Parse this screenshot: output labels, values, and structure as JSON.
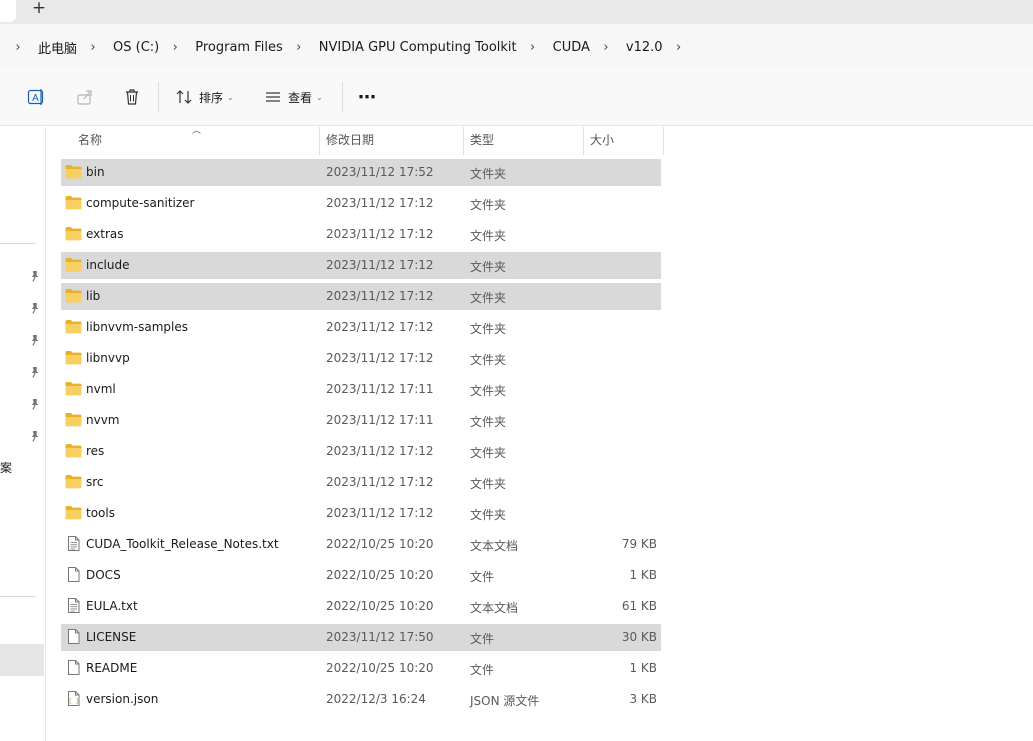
{
  "tabs": {
    "new_tab_label": "+"
  },
  "breadcrumb": [
    "此电脑",
    "OS (C:)",
    "Program Files",
    "NVIDIA GPU Computing Toolkit",
    "CUDA",
    "v12.0"
  ],
  "commandbar": {
    "sort_label": "排序",
    "view_label": "查看",
    "more_label": "⋯"
  },
  "navpane": {
    "truncated_label": "案"
  },
  "columns": {
    "name": "名称",
    "date": "修改日期",
    "type": "类型",
    "size": "大小"
  },
  "files": [
    {
      "name": "bin",
      "date": "2023/11/12 17:52",
      "type": "文件夹",
      "size": "",
      "icon": "folder-icon",
      "selected": true
    },
    {
      "name": "compute-sanitizer",
      "date": "2023/11/12 17:12",
      "type": "文件夹",
      "size": "",
      "icon": "folder-icon",
      "selected": false
    },
    {
      "name": "extras",
      "date": "2023/11/12 17:12",
      "type": "文件夹",
      "size": "",
      "icon": "folder-icon",
      "selected": false
    },
    {
      "name": "include",
      "date": "2023/11/12 17:12",
      "type": "文件夹",
      "size": "",
      "icon": "folder-icon",
      "selected": true
    },
    {
      "name": "lib",
      "date": "2023/11/12 17:12",
      "type": "文件夹",
      "size": "",
      "icon": "folder-icon",
      "selected": true
    },
    {
      "name": "libnvvm-samples",
      "date": "2023/11/12 17:12",
      "type": "文件夹",
      "size": "",
      "icon": "folder-icon",
      "selected": false
    },
    {
      "name": "libnvvp",
      "date": "2023/11/12 17:12",
      "type": "文件夹",
      "size": "",
      "icon": "folder-icon",
      "selected": false
    },
    {
      "name": "nvml",
      "date": "2023/11/12 17:11",
      "type": "文件夹",
      "size": "",
      "icon": "folder-icon",
      "selected": false
    },
    {
      "name": "nvvm",
      "date": "2023/11/12 17:11",
      "type": "文件夹",
      "size": "",
      "icon": "folder-icon",
      "selected": false
    },
    {
      "name": "res",
      "date": "2023/11/12 17:12",
      "type": "文件夹",
      "size": "",
      "icon": "folder-icon",
      "selected": false
    },
    {
      "name": "src",
      "date": "2023/11/12 17:12",
      "type": "文件夹",
      "size": "",
      "icon": "folder-icon",
      "selected": false
    },
    {
      "name": "tools",
      "date": "2023/11/12 17:12",
      "type": "文件夹",
      "size": "",
      "icon": "folder-icon",
      "selected": false
    },
    {
      "name": "CUDA_Toolkit_Release_Notes.txt",
      "date": "2022/10/25 10:20",
      "type": "文本文档",
      "size": "79 KB",
      "icon": "text-file-icon",
      "selected": false
    },
    {
      "name": "DOCS",
      "date": "2022/10/25 10:20",
      "type": "文件",
      "size": "1 KB",
      "icon": "file-icon",
      "selected": false
    },
    {
      "name": "EULA.txt",
      "date": "2022/10/25 10:20",
      "type": "文本文档",
      "size": "61 KB",
      "icon": "text-file-icon",
      "selected": false
    },
    {
      "name": "LICENSE",
      "date": "2023/11/12 17:50",
      "type": "文件",
      "size": "30 KB",
      "icon": "file-icon",
      "selected": true
    },
    {
      "name": "README",
      "date": "2022/10/25 10:20",
      "type": "文件",
      "size": "1 KB",
      "icon": "file-icon",
      "selected": false
    },
    {
      "name": "version.json",
      "date": "2022/12/3 16:24",
      "type": "JSON 源文件",
      "size": "3 KB",
      "icon": "json-file-icon",
      "selected": false
    }
  ],
  "colors": {
    "selected_row": "#d9d9d9",
    "folder_yellow": "#f4c542",
    "accent_blue": "#1a5fb4"
  }
}
